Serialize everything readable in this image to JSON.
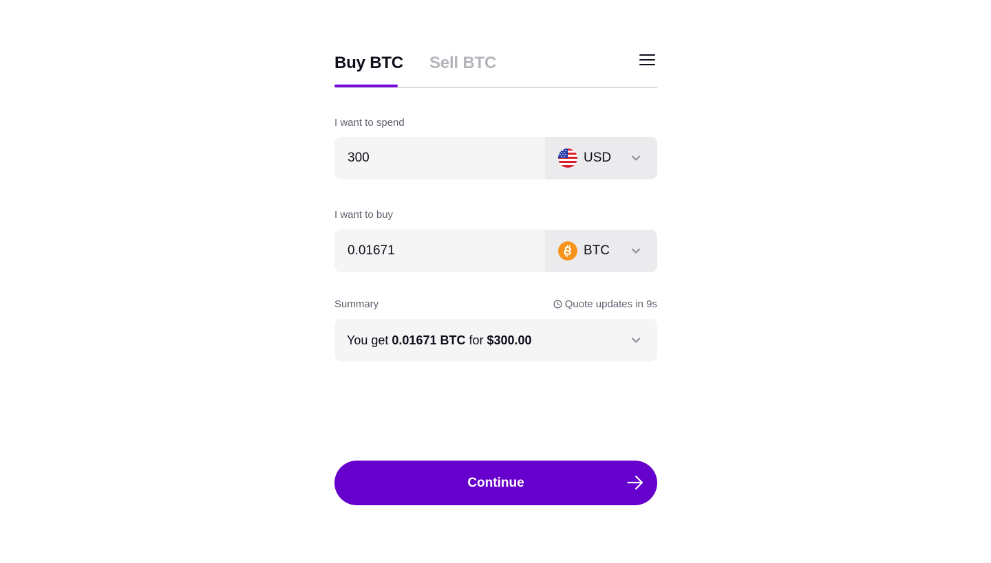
{
  "tabs": {
    "buy_label": "Buy BTC",
    "sell_label": "Sell BTC",
    "active": "buy"
  },
  "menu": {
    "icon": "hamburger-menu-icon"
  },
  "spend": {
    "label": "I want to spend",
    "amount": "300",
    "currency_code": "USD",
    "currency_icon": "us-flag-icon"
  },
  "buy": {
    "label": "I want to buy",
    "amount": "0.01671",
    "currency_code": "BTC",
    "currency_icon": "bitcoin-icon"
  },
  "summary": {
    "label": "Summary",
    "quote_text": "Quote updates in 9s",
    "prefix": "You get ",
    "crypto_amount": "0.01671 BTC",
    "middle": " for ",
    "fiat_amount": "$300.00"
  },
  "continue": {
    "label": "Continue",
    "icon": "arrow-right-icon"
  },
  "colors": {
    "accent": "#6600cc",
    "tab_underline": "#7a0be0",
    "field_bg": "#f5f5f6",
    "currency_bg": "#ebebed",
    "muted_text": "#5f5f6e",
    "inactive_tab": "#b4b4bb",
    "bitcoin_orange": "#f7931a"
  }
}
